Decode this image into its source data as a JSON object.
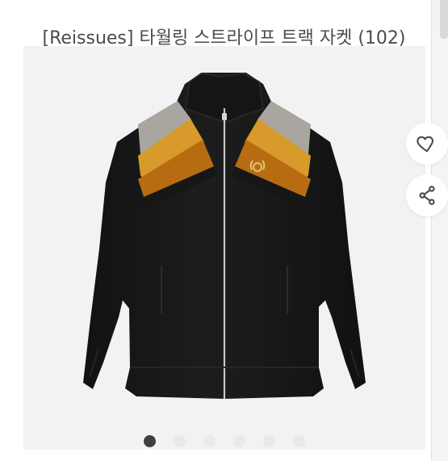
{
  "product": {
    "title": "[Reissues] 타월링 스트라이프 트랙 자켓 (102)"
  },
  "actions": {
    "like_icon": "heart-outline-icon",
    "share_icon": "share-icon"
  },
  "carousel": {
    "total": 6,
    "active_index": 0
  },
  "colors": {
    "jacket": "#171717",
    "stripe_grey": "#a5a19b",
    "stripe_gold": "#d79b2c",
    "stripe_brown": "#b86c12",
    "logo_gold": "#d8c67a",
    "dot_active": "#3f3f3f",
    "dot_inactive": "#e9e9e9"
  }
}
